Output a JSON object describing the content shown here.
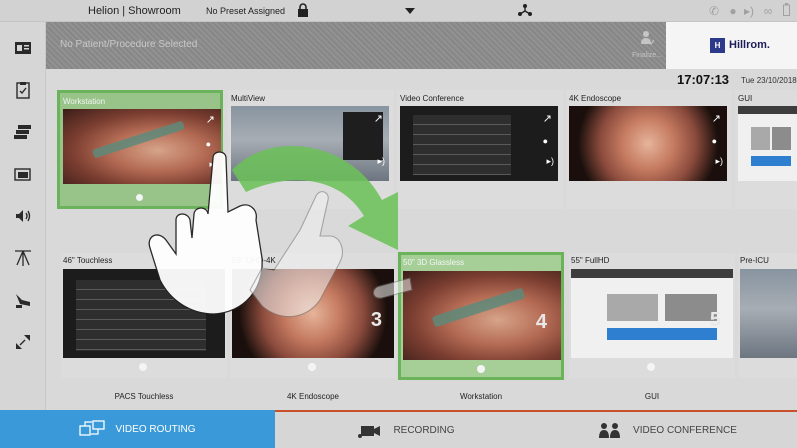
{
  "topbar": {
    "title": "Helion | Showroom",
    "preset": "No Preset Assigned",
    "icons": [
      "lock-icon",
      "dropdown-arrow-icon",
      "network-icon",
      "phone-icon",
      "record-indicator-icon",
      "speaker-icon",
      "glasses-icon",
      "battery-icon"
    ]
  },
  "sidebar": {
    "items": [
      "patient-card-icon",
      "clipboard-check-icon",
      "layers-icon",
      "windows-icon",
      "audio-icon",
      "ceiling-lights-icon",
      "surgical-lamp-icon",
      "fullscreen-expand-icon"
    ]
  },
  "patient": {
    "placeholder": "No Patient/Procedure Selected",
    "finalize_label": "Finalize...",
    "brand": "Hillrom."
  },
  "clock": {
    "time": "17:07:13",
    "date": "Tue 23/10/2018"
  },
  "sources": [
    {
      "label": "Workstation",
      "selected": true,
      "content": "surgery-video"
    },
    {
      "label": "MultiView",
      "selected": false,
      "content": "operating-room-video"
    },
    {
      "label": "Video Conference",
      "selected": false,
      "content": "dark-ui"
    },
    {
      "label": "4K Endoscope",
      "selected": false,
      "content": "endoscope-video"
    },
    {
      "label": "GUI",
      "selected": false,
      "content": "light-ui"
    }
  ],
  "destinations": [
    {
      "label": "46\" Touchless",
      "number": "",
      "selected": false,
      "content": "dark-ui"
    },
    {
      "label": "55\" UHD-4K",
      "number": "3",
      "selected": false,
      "content": "endoscope-video"
    },
    {
      "label": "50\" 3D Glassless",
      "number": "4",
      "selected": true,
      "content": "surgery-video"
    },
    {
      "label": "55\" FullHD",
      "number": "5",
      "selected": false,
      "content": "light-ui"
    },
    {
      "label": "Pre-ICU",
      "number": "",
      "selected": false,
      "content": "operating-room-video"
    }
  ],
  "destination_sources": [
    "PACS Touchless",
    "4K Endoscope",
    "Workstation",
    "GUI"
  ],
  "tabs": [
    {
      "label": "VIDEO ROUTING",
      "active": true,
      "icon": "video-routing-icon"
    },
    {
      "label": "RECORDING",
      "active": false,
      "icon": "camera-recording-icon"
    },
    {
      "label": "VIDEO CONFERENCE",
      "active": false,
      "icon": "video-conference-icon"
    }
  ],
  "colors": {
    "selected_border": "#6ab35a",
    "active_tab": "#3a9ad9",
    "tab_accent": "#c9502a",
    "arrow": "#6cc05a"
  }
}
